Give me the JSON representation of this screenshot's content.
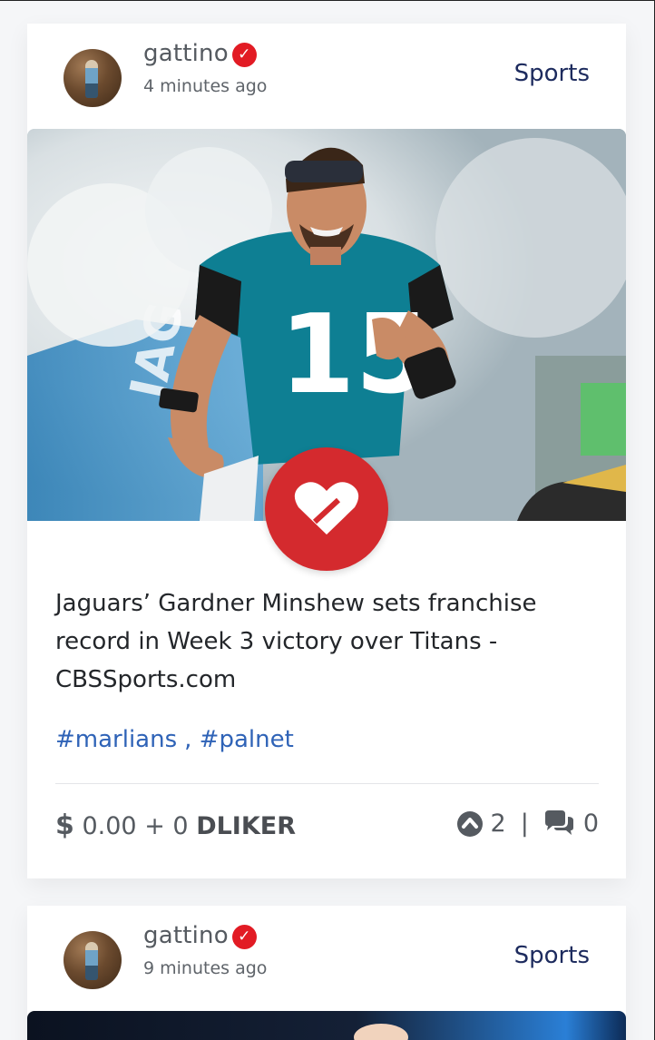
{
  "posts": [
    {
      "author": "gattino",
      "time": "4 minutes ago",
      "category": "Sports",
      "image_caption_icon": "heart-like-icon",
      "title": "Jaguars’ Gardner Minshew sets franchise record in Week 3 victory over Titans - CBSSports.com",
      "tags": [
        "#marlians",
        ", #palnet"
      ],
      "payout": {
        "symbol": "$",
        "amount": "0.00",
        "plus": "+",
        "tokens": "0",
        "token_name": "DLIKER"
      },
      "upvotes": "2",
      "separator": "|",
      "comments": "0"
    },
    {
      "author": "gattino",
      "time": "9 minutes ago",
      "category": "Sports"
    }
  ],
  "colors": {
    "accent_red": "#d42a2e",
    "verified_red": "#e21b24",
    "tag_blue": "#2f63b7",
    "category_navy": "#1d2b5e",
    "jersey_teal": "#0e7f93"
  },
  "icons": [
    "verified-check-icon",
    "heart-like-icon",
    "upvote-icon",
    "comments-icon"
  ]
}
